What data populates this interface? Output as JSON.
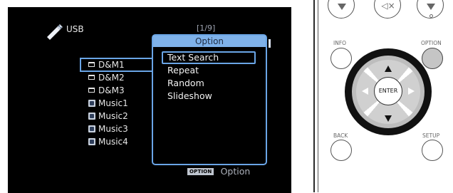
{
  "screen": {
    "source_label": "USB",
    "page_indicator": "[1/9]",
    "files": [
      {
        "name": "D&M1",
        "kind": "folder"
      },
      {
        "name": "D&M2",
        "kind": "folder"
      },
      {
        "name": "D&M3",
        "kind": "folder"
      },
      {
        "name": "Music1",
        "kind": "music"
      },
      {
        "name": "Music2",
        "kind": "music"
      },
      {
        "name": "Music3",
        "kind": "music"
      },
      {
        "name": "Music4",
        "kind": "music"
      }
    ],
    "option_popup": {
      "title": "Option",
      "items": [
        "Text Search",
        "Repeat",
        "Random",
        "Slideshow"
      ]
    },
    "footer": {
      "badge": "OPTION",
      "label": "Option"
    }
  },
  "remote": {
    "info_label": "INFO",
    "option_label": "OPTION",
    "enter_label": "ENTER",
    "back_label": "BACK",
    "setup_label": "SETUP"
  },
  "colors": {
    "highlight": "#6aa5e6",
    "popup_title_bg": "#7fb2ea",
    "screen_bg": "#000000"
  },
  "icons": [
    "usb-icon",
    "folder-icon",
    "music-file-icon",
    "volume-down-icon",
    "mute-icon",
    "volume-up-icon",
    "arrow-up-icon",
    "arrow-down-icon",
    "arrow-left-icon",
    "arrow-right-icon"
  ]
}
